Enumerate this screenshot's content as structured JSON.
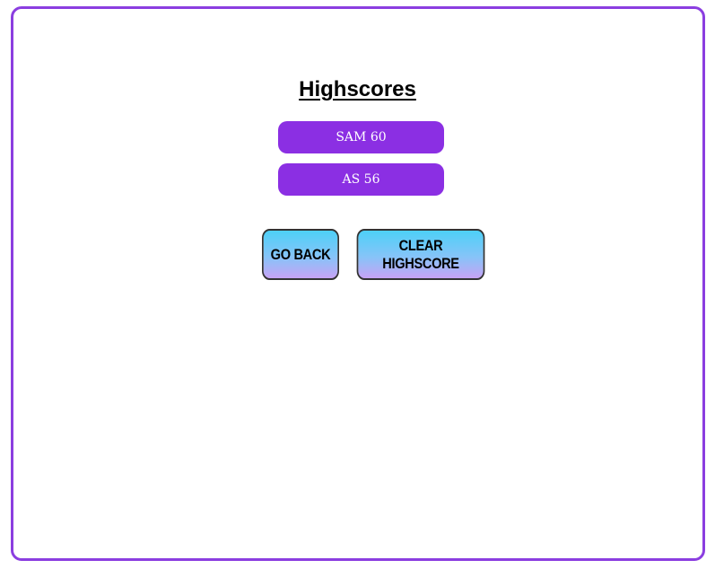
{
  "page": {
    "title": "Highscores"
  },
  "scores": [
    {
      "label": "SAM 60"
    },
    {
      "label": "AS 56"
    }
  ],
  "buttons": {
    "go_back": "GO BACK",
    "clear": "CLEAR HIGHSCORE"
  },
  "colors": {
    "frame_border": "#8b3ee0",
    "score_bg": "#8b2fe3",
    "score_text": "#ffffff",
    "button_gradient_top": "#4dd0f7",
    "button_gradient_bottom": "#c7a3f5",
    "button_border": "#333333"
  }
}
